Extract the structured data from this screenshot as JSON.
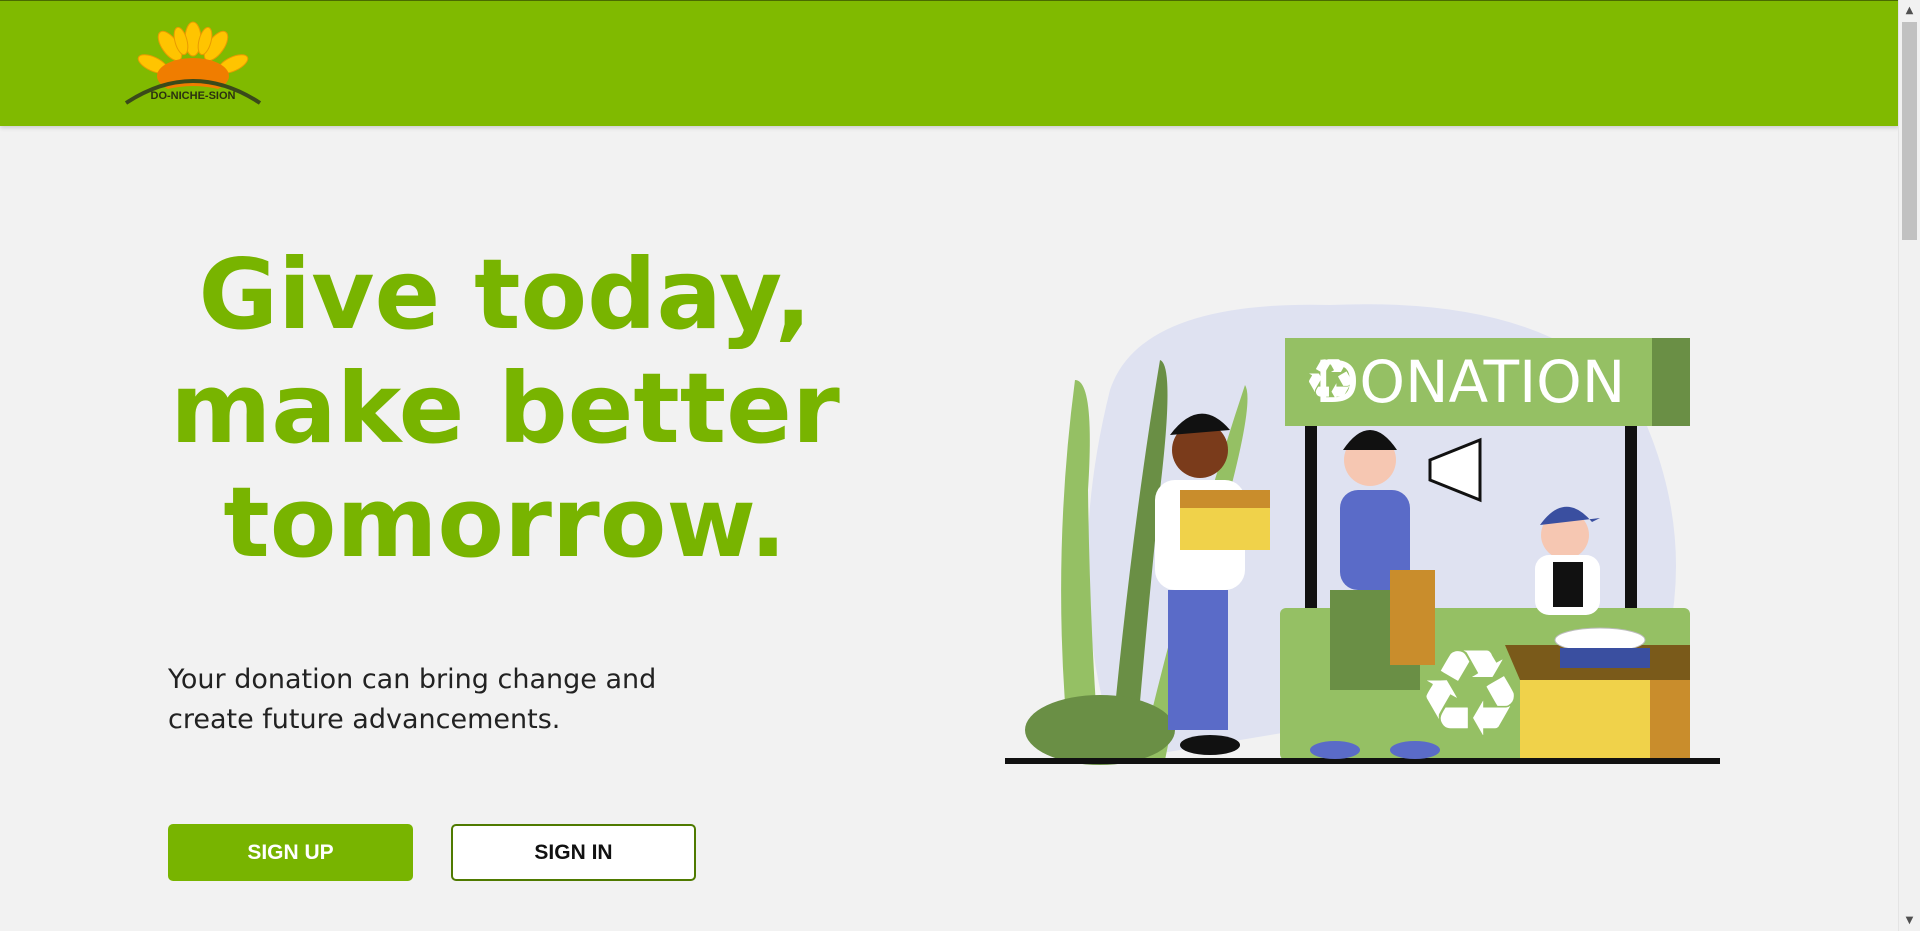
{
  "brand": {
    "logo_text": "DO-NICHE-SION"
  },
  "hero": {
    "title_lines": [
      "Give today,",
      "make better",
      "tomorrow."
    ],
    "subtitle_lines": [
      "Your donation can bring change and",
      "create future advancements."
    ]
  },
  "buttons": {
    "signup_label": "SIGN UP",
    "signin_label": "SIGN IN"
  },
  "illustration": {
    "sign_text": "DONATION"
  },
  "colors": {
    "header": "#80ba00",
    "accent": "#78b400",
    "background": "#f2f2f2"
  },
  "scrollbar": {
    "up_icon": "▲",
    "down_icon": "▼"
  }
}
